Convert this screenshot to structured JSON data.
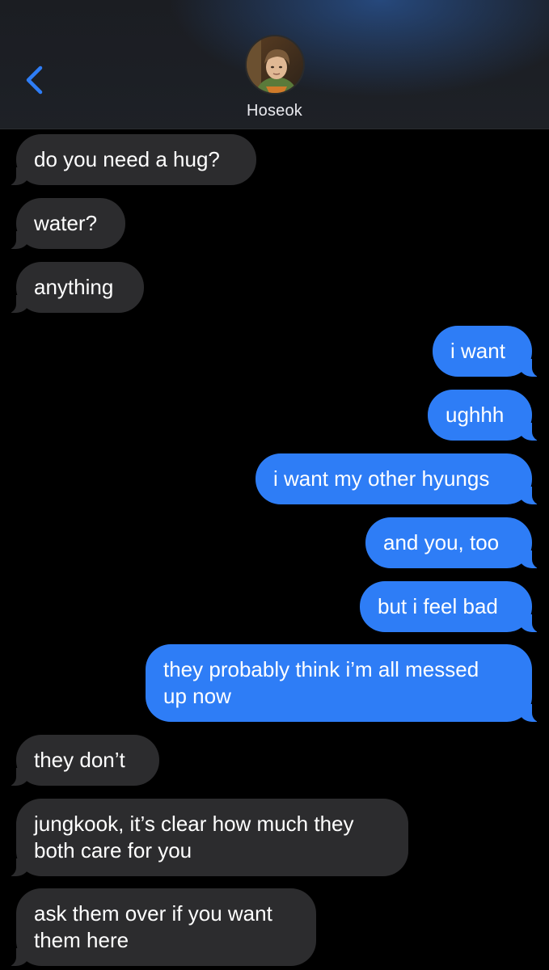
{
  "header": {
    "back_icon": "chevron-left-icon",
    "contact_name": "Hoseok",
    "accent_color": "#2e7df6"
  },
  "messages": [
    {
      "from": "contact",
      "text": "do you need a hug?"
    },
    {
      "from": "contact",
      "text": "water?"
    },
    {
      "from": "contact",
      "text": "anything"
    },
    {
      "from": "me",
      "text": "i want"
    },
    {
      "from": "me",
      "text": "ughhh"
    },
    {
      "from": "me",
      "text": "i want my other hyungs"
    },
    {
      "from": "me",
      "text": "and you, too"
    },
    {
      "from": "me",
      "text": "but i feel bad"
    },
    {
      "from": "me",
      "text": "they probably think i’m all messed\nup now"
    },
    {
      "from": "contact",
      "text": "they don’t"
    },
    {
      "from": "contact",
      "text": "jungkook, it’s clear how much they\nboth care for you"
    },
    {
      "from": "contact",
      "text": "ask them over if you want\nthem here"
    }
  ]
}
